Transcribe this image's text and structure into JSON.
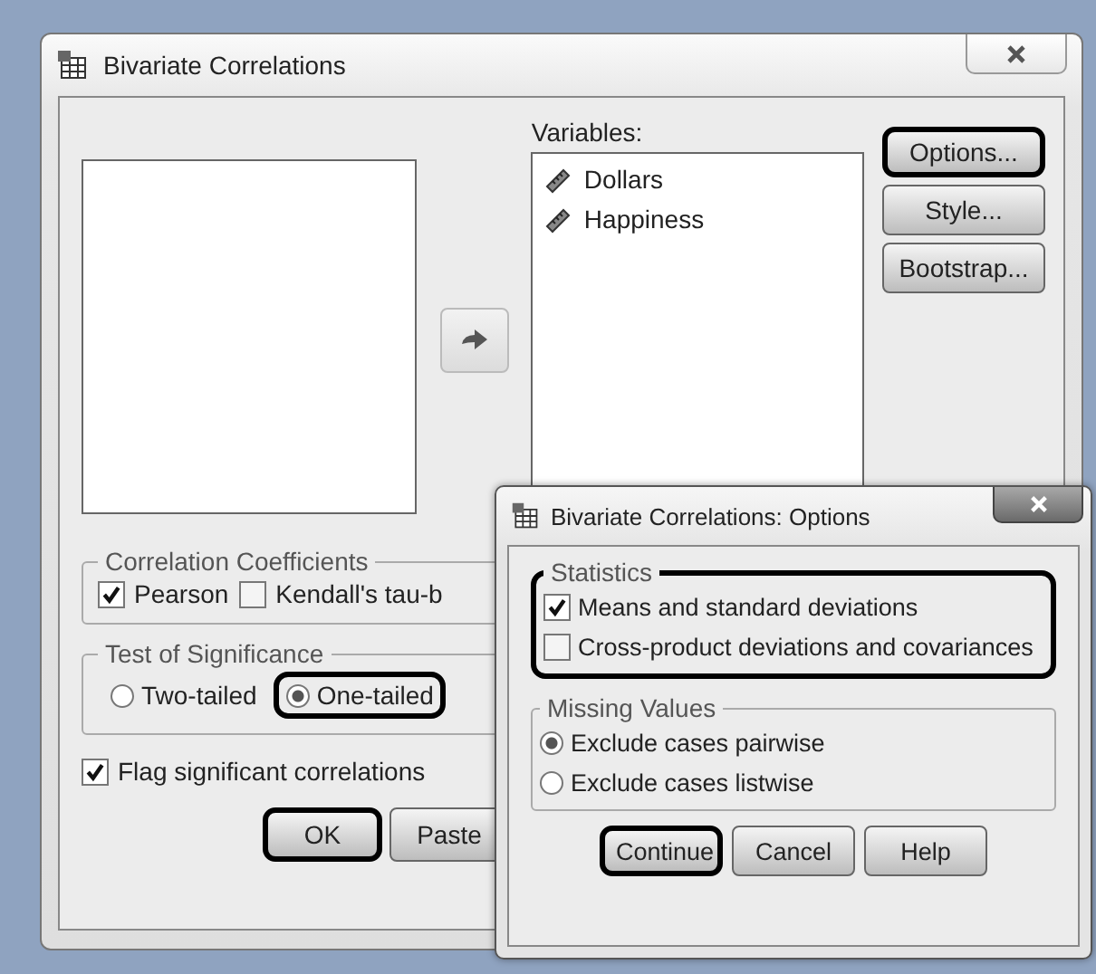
{
  "window": {
    "title": "Bivariate Correlations"
  },
  "variables": {
    "label": "Variables:",
    "items": [
      {
        "name": "Dollars"
      },
      {
        "name": "Happiness"
      }
    ]
  },
  "side_buttons": [
    {
      "label": "Options...",
      "highlighted": true
    },
    {
      "label": "Style...",
      "highlighted": false
    },
    {
      "label": "Bootstrap...",
      "highlighted": false
    }
  ],
  "correlation_coefficients": {
    "title": "Correlation Coefficients",
    "options": [
      {
        "label": "Pearson",
        "checked": true
      },
      {
        "label": "Kendall's tau-b",
        "checked": false
      }
    ]
  },
  "test_of_significance": {
    "title": "Test of Significance",
    "options": [
      {
        "label": "Two-tailed",
        "selected": false,
        "highlighted": false
      },
      {
        "label": "One-tailed",
        "selected": true,
        "highlighted": true
      }
    ]
  },
  "flag": {
    "label": "Flag significant correlations",
    "checked": true
  },
  "buttons": [
    {
      "label": "OK",
      "highlighted": true
    },
    {
      "label": "Paste",
      "highlighted": false
    }
  ],
  "options_dialog": {
    "title": "Bivariate Correlations: Options",
    "statistics": {
      "title": "Statistics",
      "highlighted": true,
      "options": [
        {
          "label": "Means and standard deviations",
          "checked": true
        },
        {
          "label": "Cross-product deviations and covariances",
          "checked": false
        }
      ]
    },
    "missing_values": {
      "title": "Missing Values",
      "options": [
        {
          "label": "Exclude cases pairwise",
          "selected": true
        },
        {
          "label": "Exclude cases listwise",
          "selected": false
        }
      ]
    },
    "buttons": [
      {
        "label": "Continue",
        "highlighted": true
      },
      {
        "label": "Cancel",
        "highlighted": false
      },
      {
        "label": "Help",
        "highlighted": false
      }
    ]
  }
}
